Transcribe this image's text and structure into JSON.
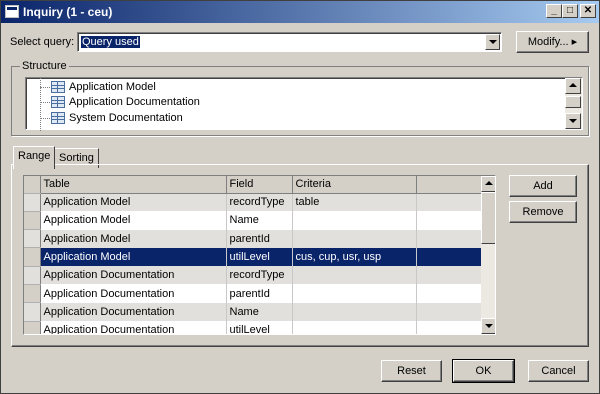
{
  "window": {
    "title": "Inquiry (1 - ceu)"
  },
  "query": {
    "label": "Select query:",
    "value": "Query used",
    "modify_label": "Modify...",
    "modify_arrow": "▸"
  },
  "structure": {
    "title": "Structure",
    "items": [
      "Application Model",
      "Application Documentation",
      "System Documentation"
    ]
  },
  "tabs": [
    "Range",
    "Sorting"
  ],
  "grid": {
    "columns": [
      "Table",
      "Field",
      "Criteria",
      ""
    ],
    "rows": [
      {
        "table": "Application Model",
        "field": "recordType",
        "criteria": "table"
      },
      {
        "table": "Application Model",
        "field": "Name",
        "criteria": ""
      },
      {
        "table": "Application Model",
        "field": "parentId",
        "criteria": ""
      },
      {
        "table": "Application Model",
        "field": "utilLevel",
        "criteria": "cus, cup, usr, usp"
      },
      {
        "table": "Application Documentation",
        "field": "recordType",
        "criteria": ""
      },
      {
        "table": "Application Documentation",
        "field": "parentId",
        "criteria": ""
      },
      {
        "table": "Application Documentation",
        "field": "Name",
        "criteria": ""
      },
      {
        "table": "Application Documentation",
        "field": "utilLevel",
        "criteria": ""
      }
    ],
    "selected_row": 3
  },
  "side_buttons": {
    "add": "Add",
    "remove": "Remove"
  },
  "footer": {
    "reset": "Reset",
    "ok": "OK",
    "cancel": "Cancel"
  },
  "colors": {
    "selection": "#0a246a",
    "titlebar": "#0a246a",
    "face": "#d4d0c8"
  }
}
